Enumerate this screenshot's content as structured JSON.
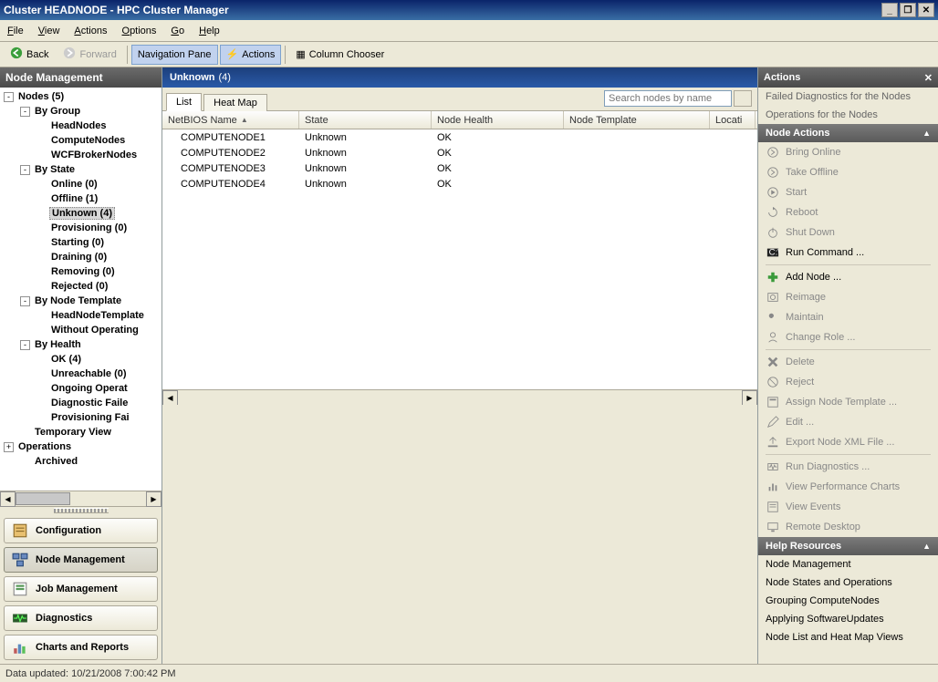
{
  "window": {
    "title": "Cluster HEADNODE - HPC Cluster Manager"
  },
  "menu": {
    "file": "File",
    "view": "View",
    "actions": "Actions",
    "options": "Options",
    "go": "Go",
    "help": "Help"
  },
  "toolbar": {
    "back": "Back",
    "forward": "Forward",
    "navpane": "Navigation Pane",
    "actions": "Actions",
    "colchooser": "Column Chooser"
  },
  "left": {
    "header": "Node Management",
    "tree": [
      {
        "d": 0,
        "exp": "-",
        "label": "Nodes (5)"
      },
      {
        "d": 1,
        "exp": "-",
        "label": "By Group"
      },
      {
        "d": 2,
        "exp": "",
        "label": "HeadNodes"
      },
      {
        "d": 2,
        "exp": "",
        "label": "ComputeNodes"
      },
      {
        "d": 2,
        "exp": "",
        "label": "WCFBrokerNodes"
      },
      {
        "d": 1,
        "exp": "-",
        "label": "By State"
      },
      {
        "d": 2,
        "exp": "",
        "label": "Online (0)"
      },
      {
        "d": 2,
        "exp": "",
        "label": "Offline (1)"
      },
      {
        "d": 2,
        "exp": "",
        "label": "Unknown (4)",
        "sel": true
      },
      {
        "d": 2,
        "exp": "",
        "label": "Provisioning (0)"
      },
      {
        "d": 2,
        "exp": "",
        "label": "Starting (0)"
      },
      {
        "d": 2,
        "exp": "",
        "label": "Draining (0)"
      },
      {
        "d": 2,
        "exp": "",
        "label": "Removing (0)"
      },
      {
        "d": 2,
        "exp": "",
        "label": "Rejected (0)"
      },
      {
        "d": 1,
        "exp": "-",
        "label": "By Node Template"
      },
      {
        "d": 2,
        "exp": "",
        "label": "HeadNodeTemplate"
      },
      {
        "d": 2,
        "exp": "",
        "label": "Without Operating"
      },
      {
        "d": 1,
        "exp": "-",
        "label": "By Health"
      },
      {
        "d": 2,
        "exp": "",
        "label": "OK (4)"
      },
      {
        "d": 2,
        "exp": "",
        "label": "Unreachable (0)"
      },
      {
        "d": 2,
        "exp": "",
        "label": "Ongoing Operat"
      },
      {
        "d": 2,
        "exp": "",
        "label": "Diagnostic Faile"
      },
      {
        "d": 2,
        "exp": "",
        "label": "Provisioning Fai"
      },
      {
        "d": 1,
        "exp": "",
        "label": "Temporary View"
      },
      {
        "d": 0,
        "exp": "+",
        "label": "Operations"
      },
      {
        "d": 1,
        "exp": "",
        "label": "Archived"
      }
    ],
    "nav": [
      {
        "label": "Configuration",
        "icon": "config"
      },
      {
        "label": "Node Management",
        "icon": "nodes",
        "active": true
      },
      {
        "label": "Job Management",
        "icon": "jobs"
      },
      {
        "label": "Diagnostics",
        "icon": "diag"
      },
      {
        "label": "Charts and Reports",
        "icon": "charts"
      }
    ]
  },
  "center": {
    "title": "Unknown",
    "count": "(4)",
    "tabs": {
      "list": "List",
      "heat": "Heat Map"
    },
    "search": {
      "placeholder": "Search nodes by name"
    },
    "cols": {
      "c1": "NetBIOS Name",
      "c2": "State",
      "c3": "Node Health",
      "c4": "Node Template",
      "c5": "Locati"
    },
    "rows": [
      {
        "name": "COMPUTENODE1",
        "state": "Unknown",
        "health": "OK"
      },
      {
        "name": "COMPUTENODE2",
        "state": "Unknown",
        "health": "OK"
      },
      {
        "name": "COMPUTENODE3",
        "state": "Unknown",
        "health": "OK"
      },
      {
        "name": "COMPUTENODE4",
        "state": "Unknown",
        "health": "OK"
      }
    ]
  },
  "right": {
    "header": "Actions",
    "topLinks": [
      "Failed Diagnostics for the Nodes",
      "Operations for the Nodes"
    ],
    "section1": "Node Actions",
    "items": [
      {
        "label": "Bring Online",
        "icon": "arrow-right",
        "enabled": false
      },
      {
        "label": "Take Offline",
        "icon": "arrow-right",
        "enabled": false
      },
      {
        "label": "Start",
        "icon": "play",
        "enabled": false
      },
      {
        "label": "Reboot",
        "icon": "reboot",
        "enabled": false
      },
      {
        "label": "Shut Down",
        "icon": "power",
        "enabled": false
      },
      {
        "label": "Run Command ...",
        "icon": "cmd",
        "enabled": true,
        "hr": true
      },
      {
        "label": "Add Node ...",
        "icon": "plus",
        "enabled": true
      },
      {
        "label": "Reimage",
        "icon": "reimage",
        "enabled": false
      },
      {
        "label": "Maintain",
        "icon": "wrench",
        "enabled": false
      },
      {
        "label": "Change Role ...",
        "icon": "role",
        "enabled": false,
        "hr": true
      },
      {
        "label": "Delete",
        "icon": "x",
        "enabled": false
      },
      {
        "label": "Reject",
        "icon": "stop",
        "enabled": false
      },
      {
        "label": "Assign Node Template ...",
        "icon": "template",
        "enabled": false
      },
      {
        "label": "Edit ...",
        "icon": "edit",
        "enabled": false
      },
      {
        "label": "Export Node XML File ...",
        "icon": "export",
        "enabled": false,
        "hr": true
      },
      {
        "label": "Run Diagnostics ...",
        "icon": "diag",
        "enabled": false
      },
      {
        "label": "View Performance Charts",
        "icon": "chart",
        "enabled": false
      },
      {
        "label": "View Events",
        "icon": "events",
        "enabled": false
      },
      {
        "label": "Remote Desktop",
        "icon": "rdp",
        "enabled": false
      }
    ],
    "section2": "Help Resources",
    "help": [
      "Node Management",
      "Node States and Operations",
      "Grouping ComputeNodes",
      "Applying SoftwareUpdates",
      "Node List and Heat Map Views"
    ]
  },
  "status": "Data updated: 10/21/2008 7:00:42 PM"
}
